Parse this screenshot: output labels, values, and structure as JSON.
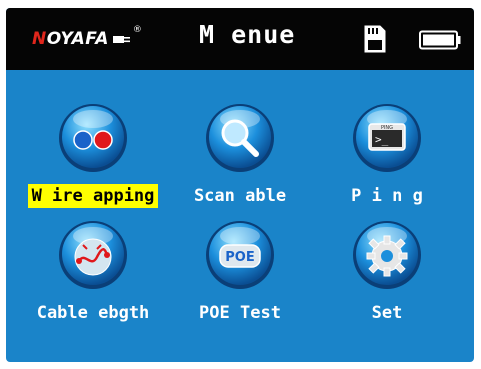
{
  "header": {
    "brand_prefix": "N",
    "brand_rest": "OYAFA",
    "brand_reg": "®",
    "title": "M enue",
    "icons": [
      "sd-card-icon",
      "battery-icon"
    ]
  },
  "menu": {
    "items": [
      {
        "label": "W ire  apping",
        "icon": "wire-mapping-icon",
        "selected": true
      },
      {
        "label": "Scan  able",
        "icon": "scan-cable-icon",
        "selected": false
      },
      {
        "label": "P i n g",
        "icon": "ping-icon",
        "selected": false
      },
      {
        "label": "Cable  ebgth",
        "icon": "cable-length-icon",
        "selected": false
      },
      {
        "label": "POE Test",
        "icon": "poe-test-icon",
        "selected": false
      },
      {
        "label": "Set",
        "icon": "settings-gear-icon",
        "selected": false
      }
    ]
  },
  "icon_texts": {
    "ping_screen_label": "PING",
    "ping_prompt": ">_",
    "poe_text": "POE"
  },
  "colors": {
    "background": "#1a84c9",
    "topbar": "#050505",
    "selected_highlight": "#ffff00"
  }
}
